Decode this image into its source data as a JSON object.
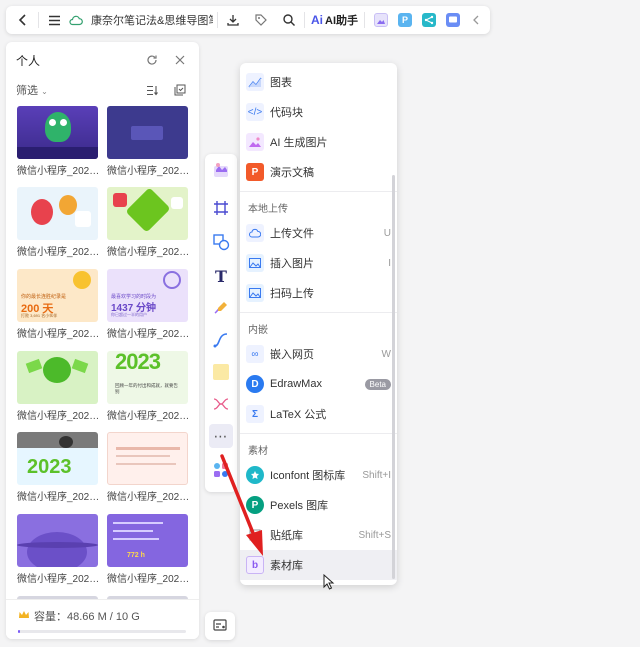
{
  "toolbar": {
    "doc_title": "康奈尔笔记法&思维导图笔…",
    "ai_label": "AI助手",
    "ai_logo": "Ai"
  },
  "panel": {
    "title": "个人",
    "filter_label": "筛选",
    "thumb_caption": "微信小程序_202…",
    "thumbs": [
      {
        "caption": "微信小程序_202…"
      },
      {
        "caption": "微信小程序_202…"
      },
      {
        "caption": "微信小程序_202…"
      },
      {
        "caption": "微信小程序_202…"
      },
      {
        "caption": "微信小程序_202…",
        "text1": "你的最长连胜纪录是",
        "text2": "200 天",
        "text3": "打败 3,691 名小伙伴"
      },
      {
        "caption": "微信小程序_202…",
        "text1": "最喜欢学习的时段为",
        "text2": "1437 分钟",
        "text3": "你已超过一半的用户"
      },
      {
        "caption": "微信小程序_202…"
      },
      {
        "caption": "微信小程序_202…",
        "text1": "回顾一年的付出和成就，就要告别",
        "text2": "2023"
      },
      {
        "caption": "微信小程序_202…"
      },
      {
        "caption": "微信小程序_202…"
      },
      {
        "caption": "微信小程序_202…"
      },
      {
        "caption": "微信小程序_202…",
        "text2": "772 h"
      }
    ],
    "storage_label": "容量：48.66 M / 10 G",
    "storage_fraction": 0.005
  },
  "menu": {
    "items_top": [
      {
        "label": "图表",
        "icon": "chart-icon"
      },
      {
        "label": "代码块",
        "icon": "code-block-icon"
      },
      {
        "label": "AI 生成图片",
        "icon": "ai-image-icon"
      },
      {
        "label": "演示文稿",
        "icon": "presentation-icon"
      }
    ],
    "section_upload": "本地上传",
    "items_upload": [
      {
        "label": "上传文件",
        "key": "U",
        "icon": "upload-file-icon"
      },
      {
        "label": "插入图片",
        "key": "I",
        "icon": "insert-image-icon"
      },
      {
        "label": "扫码上传",
        "key": "",
        "icon": "scan-upload-icon"
      }
    ],
    "section_embed": "内嵌",
    "items_embed": [
      {
        "label": "嵌入网页",
        "key": "W",
        "icon": "embed-web-icon"
      },
      {
        "label": "EdrawMax",
        "badge": "Beta",
        "icon": "edrawmax-icon"
      },
      {
        "label": "LaTeX 公式",
        "icon": "latex-icon"
      }
    ],
    "section_assets": "素材",
    "items_assets": [
      {
        "label": "Iconfont 图标库",
        "key": "Shift+I",
        "icon": "iconfont-icon"
      },
      {
        "label": "Pexels 图库",
        "key": "",
        "icon": "pexels-icon"
      },
      {
        "label": "贴纸库",
        "key": "Shift+S",
        "icon": "sticker-icon"
      },
      {
        "label": "素材库",
        "key": "",
        "icon": "material-library-icon"
      }
    ]
  },
  "colors": {
    "accent": "#7a5af8",
    "ai_blue": "#4a55e8",
    "arrow_red": "#e02020"
  }
}
